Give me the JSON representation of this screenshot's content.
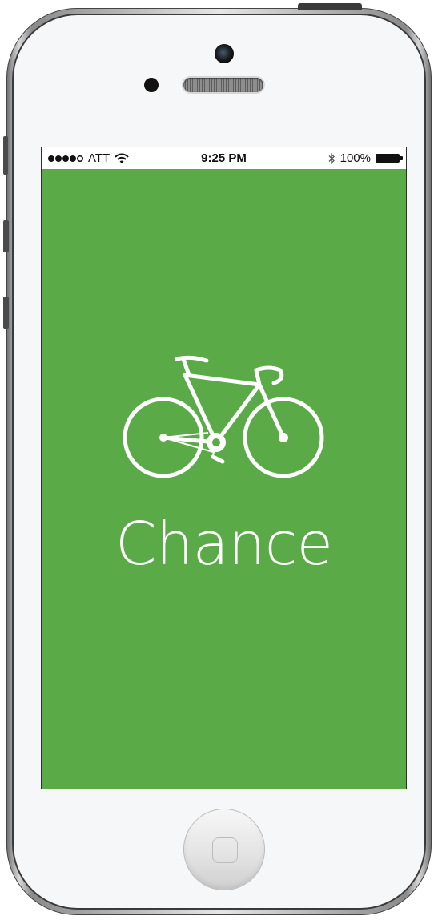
{
  "status_bar": {
    "carrier": "ATT",
    "time": "9:25 PM",
    "battery": "100%",
    "signal_bars_filled": 4,
    "signal_bars_total": 5
  },
  "app": {
    "name": "Chance",
    "background_color": "#5aab48",
    "logo_icon": "bicycle-icon"
  }
}
